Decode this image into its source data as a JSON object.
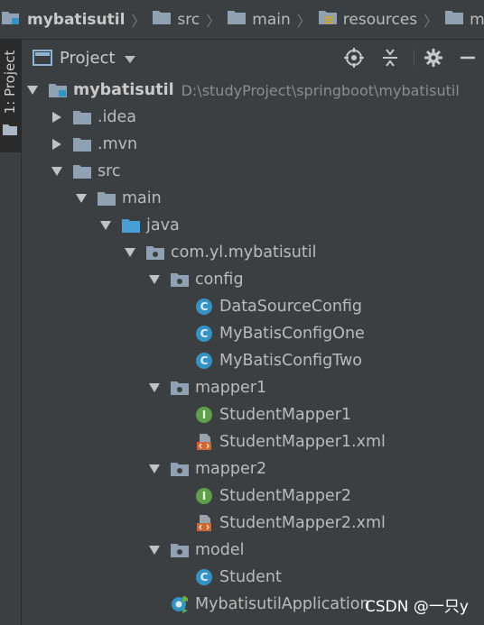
{
  "breadcrumb": [
    {
      "label": "mybatisutil",
      "bold": true,
      "icon": "module-folder-icon"
    },
    {
      "label": "src",
      "bold": false,
      "icon": "folder-icon"
    },
    {
      "label": "main",
      "bold": false,
      "icon": "folder-icon"
    },
    {
      "label": "resources",
      "bold": false,
      "icon": "resources-folder-icon"
    },
    {
      "label": "mapper",
      "bold": false,
      "icon": "folder-icon"
    }
  ],
  "side_tab": {
    "label": "1: Project"
  },
  "header": {
    "title": "Project",
    "dropdown_icon": "caret-down-icon",
    "buttons": [
      "locate-icon",
      "collapse-icon",
      "gear-icon",
      "minimize-icon"
    ]
  },
  "tree": [
    {
      "label": "mybatisutil",
      "path": "D:\\studyProject\\springboot\\mybatisutil",
      "bold": true,
      "depth": 0,
      "arrow": "down",
      "icon": "module-folder"
    },
    {
      "label": ".idea",
      "depth": 1,
      "arrow": "right",
      "icon": "folder"
    },
    {
      "label": ".mvn",
      "depth": 1,
      "arrow": "right",
      "icon": "folder"
    },
    {
      "label": "src",
      "depth": 1,
      "arrow": "down",
      "icon": "folder"
    },
    {
      "label": "main",
      "depth": 2,
      "arrow": "down",
      "icon": "folder"
    },
    {
      "label": "java",
      "depth": 3,
      "arrow": "down",
      "icon": "source-folder"
    },
    {
      "label": "com.yl.mybatisutil",
      "depth": 4,
      "arrow": "down",
      "icon": "package"
    },
    {
      "label": "config",
      "depth": 5,
      "arrow": "down",
      "icon": "package"
    },
    {
      "label": "DataSourceConfig",
      "depth": 6,
      "arrow": "none",
      "icon": "class"
    },
    {
      "label": "MyBatisConfigOne",
      "depth": 6,
      "arrow": "none",
      "icon": "class"
    },
    {
      "label": "MyBatisConfigTwo",
      "depth": 6,
      "arrow": "none",
      "icon": "class"
    },
    {
      "label": "mapper1",
      "depth": 5,
      "arrow": "down",
      "icon": "package"
    },
    {
      "label": "StudentMapper1",
      "depth": 6,
      "arrow": "none",
      "icon": "interface"
    },
    {
      "label": "StudentMapper1.xml",
      "depth": 6,
      "arrow": "none",
      "icon": "xml"
    },
    {
      "label": "mapper2",
      "depth": 5,
      "arrow": "down",
      "icon": "package"
    },
    {
      "label": "StudentMapper2",
      "depth": 6,
      "arrow": "none",
      "icon": "interface"
    },
    {
      "label": "StudentMapper2.xml",
      "depth": 6,
      "arrow": "none",
      "icon": "xml"
    },
    {
      "label": "model",
      "depth": 5,
      "arrow": "down",
      "icon": "package"
    },
    {
      "label": "Student",
      "depth": 6,
      "arrow": "none",
      "icon": "class"
    },
    {
      "label": "MybatisutilApplication",
      "depth": 5,
      "arrow": "none",
      "icon": "spring-app"
    }
  ],
  "watermark": "CSDN @一只y",
  "colors": {
    "background": "#3c3f41",
    "text": "#bbbbbb",
    "folder": "#8fa1b3",
    "source_folder": "#4a9ed6",
    "class": "#3592c4",
    "interface": "#5f9e4b",
    "xml": "#cc6633"
  }
}
